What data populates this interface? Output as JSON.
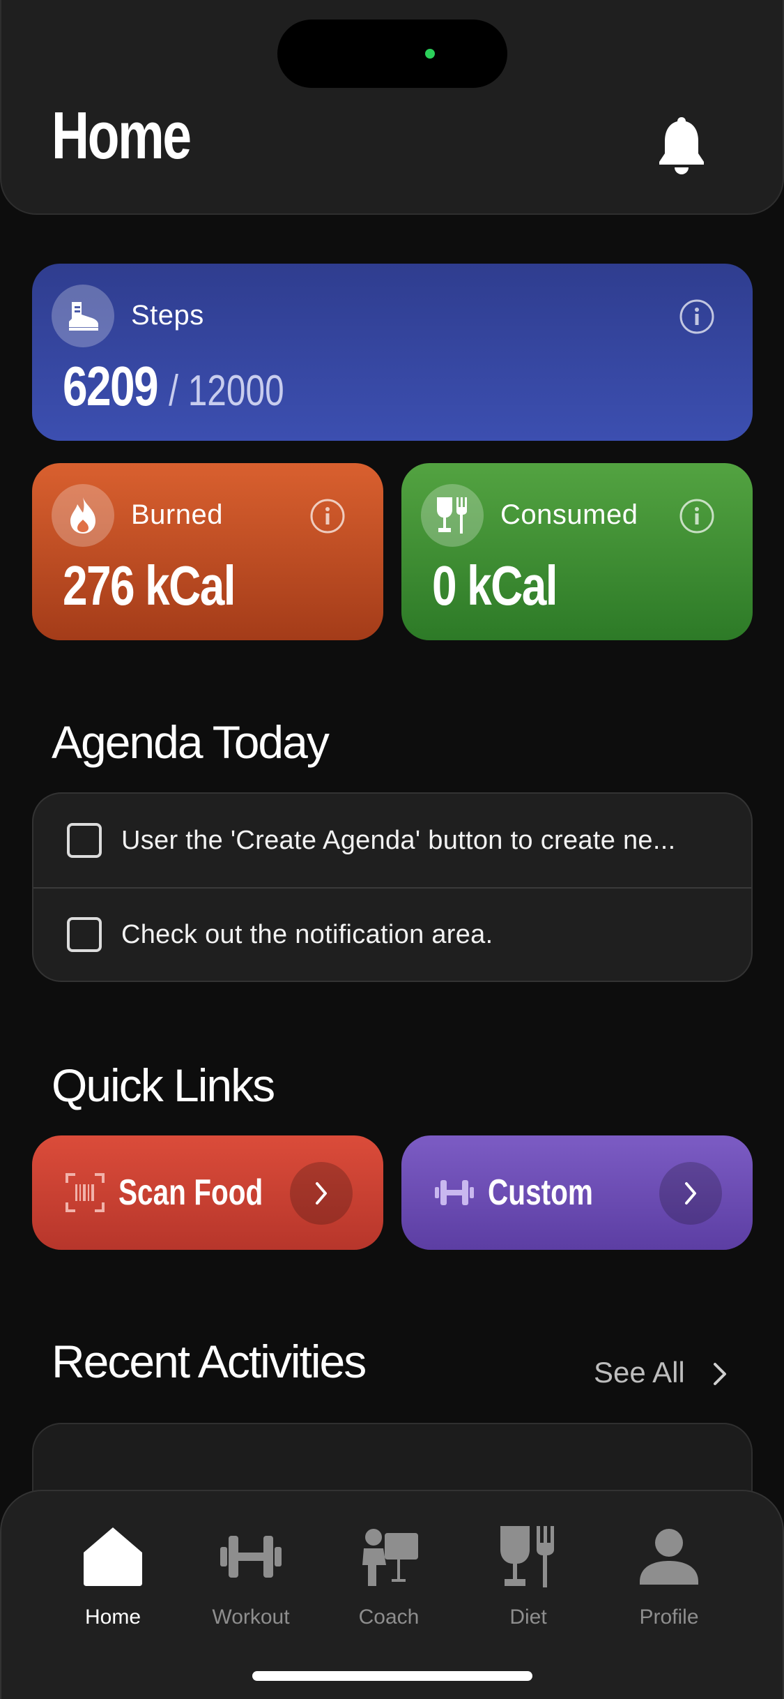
{
  "header": {
    "title": "Home"
  },
  "cards": {
    "steps": {
      "label": "Steps",
      "value": "6209",
      "goal": "/ 12000"
    },
    "burned": {
      "label": "Burned",
      "value": "276 kCal"
    },
    "consumed": {
      "label": "Consumed",
      "value": "0 kCal"
    }
  },
  "agenda": {
    "title": "Agenda Today",
    "items": [
      {
        "text": "User the 'Create Agenda' button to create ne..."
      },
      {
        "text": "Check out the notification area."
      }
    ]
  },
  "quick_links": {
    "title": "Quick Links",
    "items": [
      {
        "label": "Scan Food",
        "icon": "scan-barcode-icon"
      },
      {
        "label": "Custom",
        "icon": "dumbbell-icon"
      }
    ]
  },
  "recent": {
    "title": "Recent Activities",
    "see_all": "See All"
  },
  "tabs": [
    {
      "label": "Home",
      "icon": "home-icon",
      "active": true
    },
    {
      "label": "Workout",
      "icon": "dumbbell-icon"
    },
    {
      "label": "Coach",
      "icon": "coach-icon"
    },
    {
      "label": "Diet",
      "icon": "diet-icon"
    },
    {
      "label": "Profile",
      "icon": "profile-icon"
    }
  ],
  "colors": {
    "steps": "#3c4fb0",
    "burned": "#d9602f",
    "consumed": "#53a341",
    "scan": "#db4c3a",
    "custom": "#7c5cc4"
  }
}
